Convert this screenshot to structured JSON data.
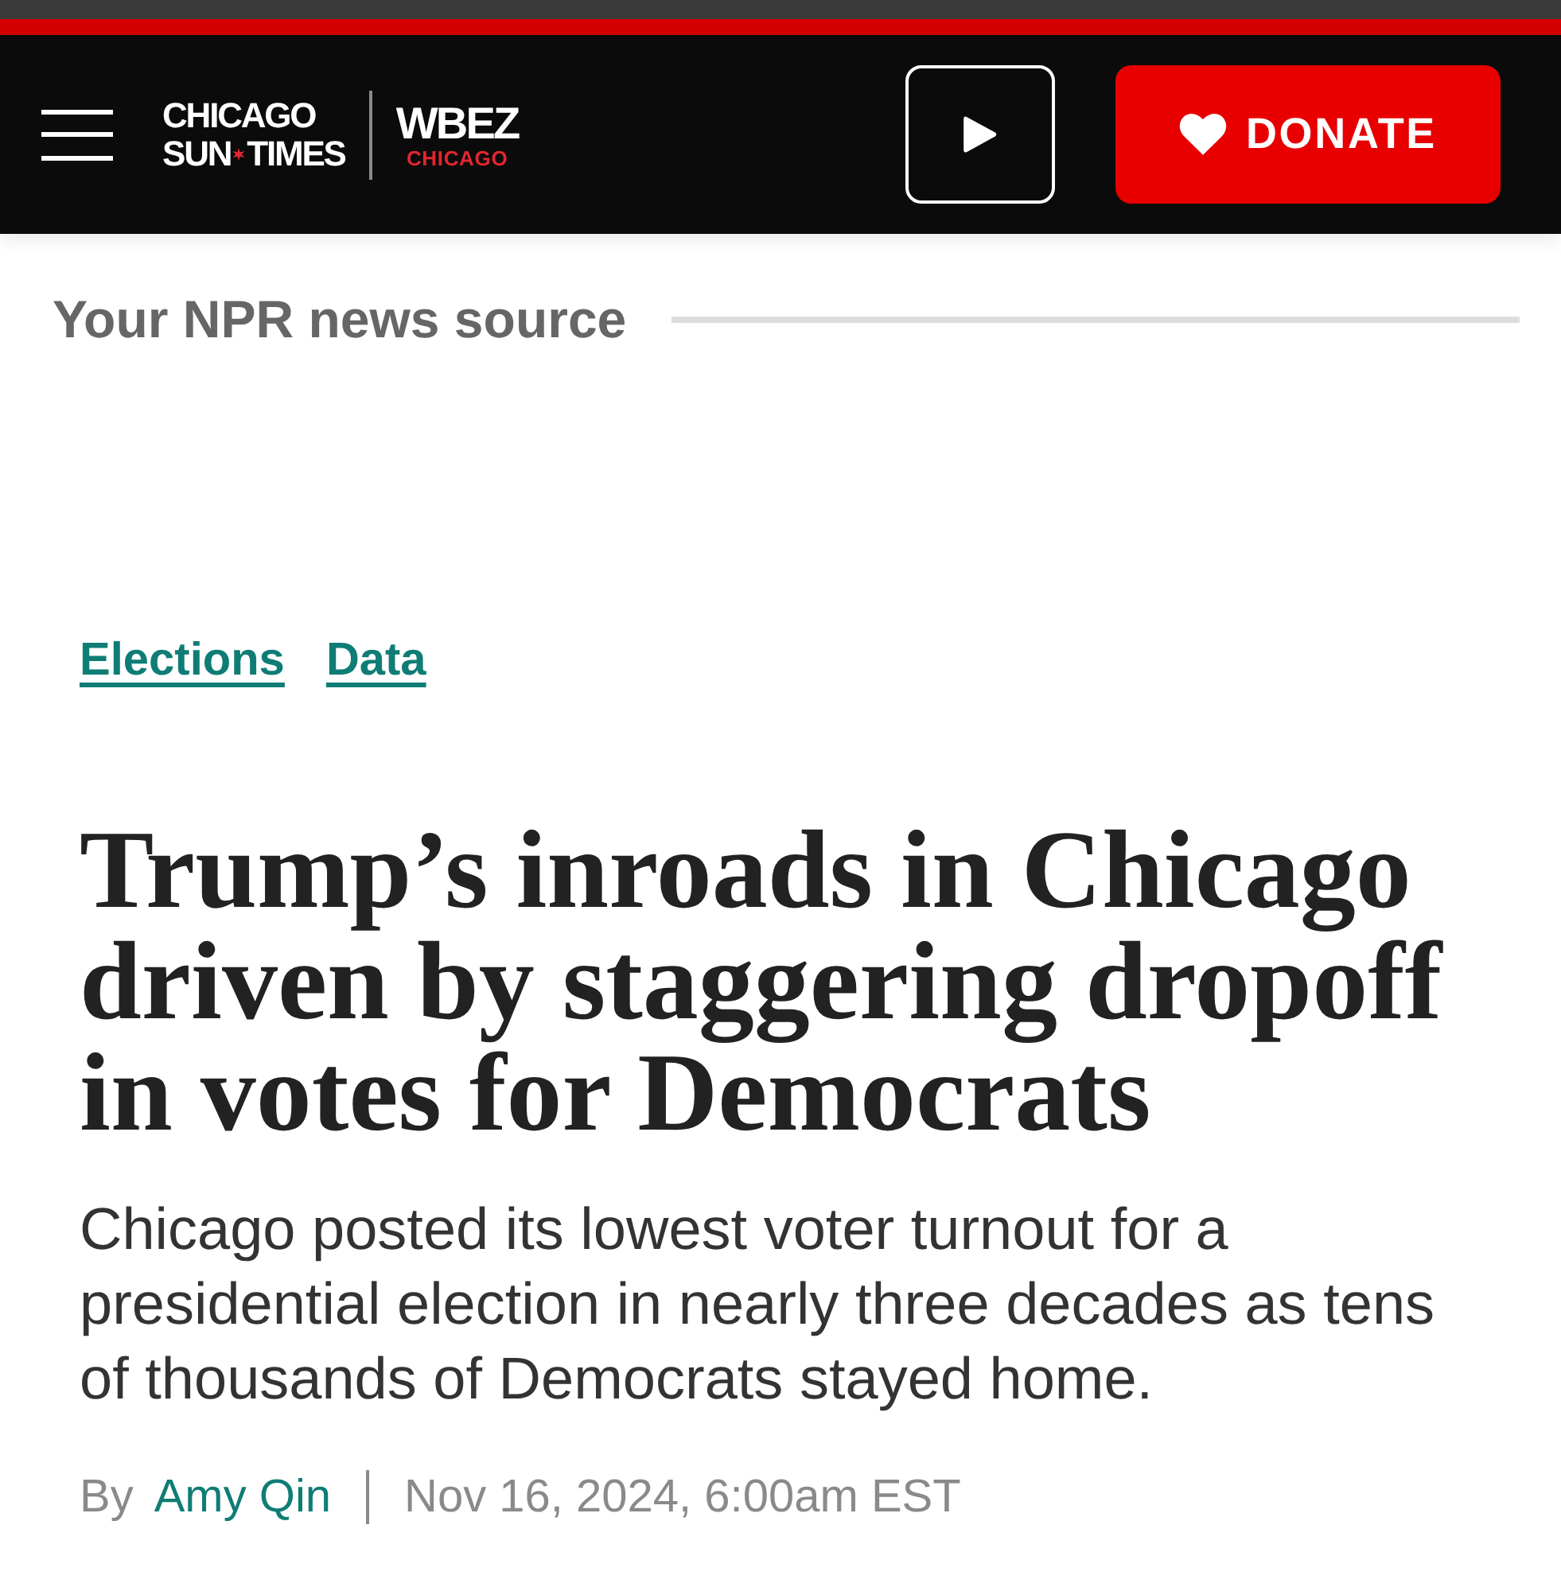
{
  "header": {
    "logo": {
      "line_1": "CHICAGO",
      "line_2_left": "SUN",
      "line_2_right": "TIMES"
    },
    "partner_logo": {
      "name": "WBEZ",
      "city": "CHICAGO"
    },
    "donate_button": {
      "label": "DONATE"
    }
  },
  "tagline": "Your NPR news source",
  "article": {
    "tags": [
      "Elections",
      "Data"
    ],
    "headline": "Trump’s inroads in Chicago driven by staggering dropoff in votes for Democrats",
    "dek": "Chicago posted its lowest voter turnout for a presidential election in nearly three decades as tens of thousands of Democrats stayed home.",
    "byline": {
      "prefix": "By",
      "author": "Amy Qin",
      "date": "Nov 16, 2024, 6:00am EST"
    }
  }
}
